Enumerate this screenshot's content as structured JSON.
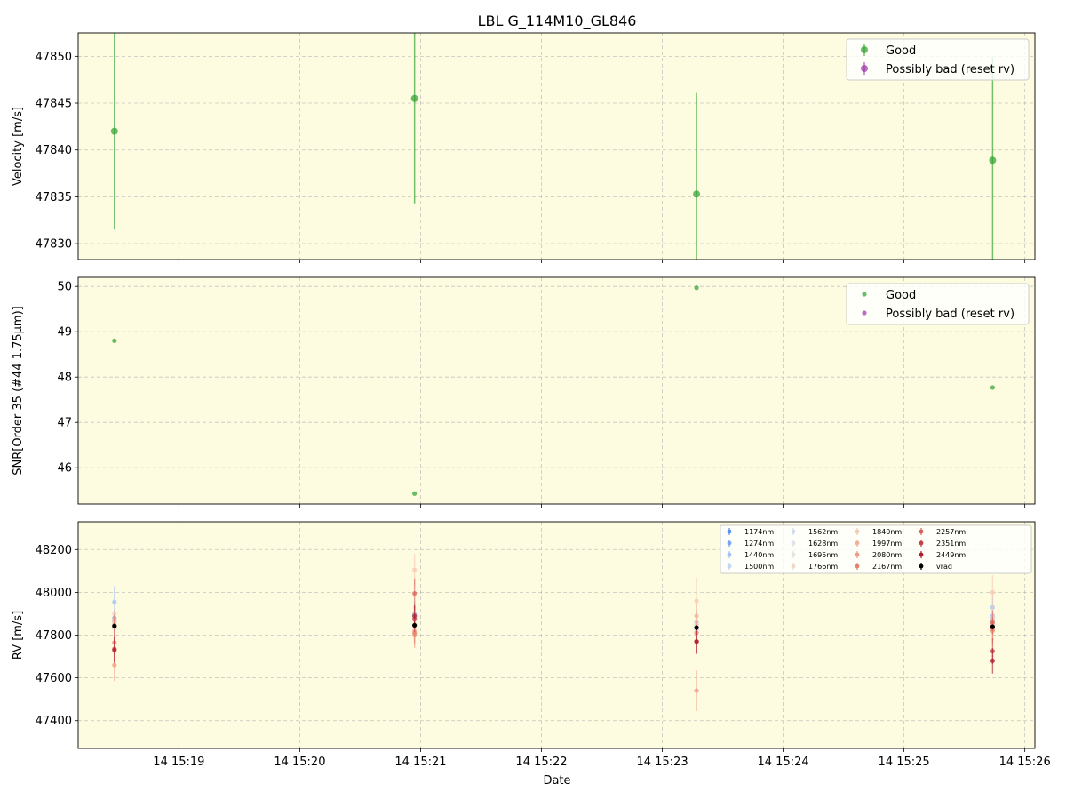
{
  "title": "LBL G_114M10_GL846",
  "xlabel": "Date",
  "x_tick_labels": [
    "14 15:19",
    "14 15:20",
    "14 15:21",
    "14 15:22",
    "14 15:23",
    "14 15:24",
    "14 15:25",
    "14 15:26"
  ],
  "colors": {
    "good": "#2ca02c",
    "bad": "#9b30a8",
    "panel_bg": "#fdfce0",
    "grid": "#b0b0b0",
    "vrad": "#000000"
  },
  "chart_data": [
    {
      "type": "scatter",
      "panel": "velocity",
      "ylabel": "Velocity [m/s]",
      "y_tick_labels": [
        "47830",
        "47835",
        "47840",
        "47845",
        "47850"
      ],
      "ylim": [
        47828.3,
        47852.5
      ],
      "xlim": [
        "15:18:10",
        "15:26:05"
      ],
      "grid": true,
      "legend_position": "upper right",
      "legend": [
        "Good",
        "Possibly bad (reset rv)"
      ],
      "series": [
        {
          "name": "Good",
          "color": "#2ca02c",
          "errorbars": true,
          "points": [
            {
              "x": "15:18:28",
              "y": 47842.0,
              "err": 10.5
            },
            {
              "x": "15:20:57",
              "y": 47845.5,
              "err": 11.2
            },
            {
              "x": "15:23:17",
              "y": 47835.3,
              "err": 10.8
            },
            {
              "x": "15:25:44",
              "y": 47838.9,
              "err": 11.0
            }
          ]
        },
        {
          "name": "Possibly bad (reset rv)",
          "color": "#9b30a8",
          "errorbars": true,
          "points": []
        }
      ]
    },
    {
      "type": "scatter",
      "panel": "snr",
      "ylabel": "SNR[Order 35 (#44 1.75μm)]",
      "y_tick_labels": [
        "46",
        "47",
        "48",
        "49",
        "50"
      ],
      "ylim": [
        45.2,
        50.2
      ],
      "xlim": [
        "15:18:10",
        "15:26:05"
      ],
      "grid": true,
      "legend_position": "upper right",
      "legend": [
        "Good",
        "Possibly bad (reset rv)"
      ],
      "series": [
        {
          "name": "Good",
          "color": "#2ca02c",
          "points": [
            {
              "x": "15:18:28",
              "y": 48.8
            },
            {
              "x": "15:20:57",
              "y": 45.43
            },
            {
              "x": "15:23:17",
              "y": 49.97
            },
            {
              "x": "15:25:44",
              "y": 47.77
            }
          ]
        },
        {
          "name": "Possibly bad (reset rv)",
          "color": "#9b30a8",
          "points": []
        }
      ]
    },
    {
      "type": "scatter",
      "panel": "rv",
      "ylabel": "RV [m/s]",
      "y_tick_labels": [
        "47400",
        "47600",
        "47800",
        "48000",
        "48200"
      ],
      "ylim": [
        47270,
        48330
      ],
      "xlim": [
        "15:18:10",
        "15:26:05"
      ],
      "grid": true,
      "legend_position": "upper right",
      "legend_columns": 5,
      "x": [
        "15:18:28",
        "15:20:57",
        "15:23:17",
        "15:25:44"
      ],
      "series": [
        {
          "name": "1174nm",
          "color": "#5b8ff0",
          "values": [
            47870,
            47880,
            47850,
            47880
          ],
          "err": [
            45,
            45,
            50,
            45
          ]
        },
        {
          "name": "1274nm",
          "color": "#7aa5f5",
          "values": [
            47880,
            47890,
            47830,
            47890
          ],
          "err": [
            40,
            40,
            45,
            40
          ]
        },
        {
          "name": "1440nm",
          "color": "#a3c1f7",
          "values": [
            47955,
            47900,
            47860,
            47930
          ],
          "err": [
            75,
            60,
            55,
            55
          ]
        },
        {
          "name": "1500nm",
          "color": "#c2d6f6",
          "values": [
            47860,
            47890,
            47840,
            47890
          ],
          "err": [
            55,
            45,
            45,
            45
          ]
        },
        {
          "name": "1562nm",
          "color": "#d0dcee",
          "values": [
            47900,
            47880,
            47850,
            47870
          ],
          "err": [
            45,
            40,
            45,
            40
          ]
        },
        {
          "name": "1628nm",
          "color": "#dde4ec",
          "values": [
            47830,
            47870,
            47820,
            47860
          ],
          "err": [
            50,
            45,
            45,
            45
          ]
        },
        {
          "name": "1695nm",
          "color": "#e6e3dc",
          "values": [
            47850,
            47880,
            47830,
            47860
          ],
          "err": [
            45,
            45,
            50,
            45
          ]
        },
        {
          "name": "1766nm",
          "color": "#f2d8cb",
          "values": [
            47870,
            47880,
            47850,
            47880
          ],
          "err": [
            40,
            40,
            45,
            40
          ]
        },
        {
          "name": "1840nm",
          "color": "#f6c9b2",
          "values": [
            47860,
            48105,
            47960,
            48000
          ],
          "err": [
            50,
            75,
            110,
            80
          ]
        },
        {
          "name": "1997nm",
          "color": "#f3b197",
          "values": [
            47870,
            47820,
            47890,
            47850
          ],
          "err": [
            50,
            50,
            55,
            50
          ]
        },
        {
          "name": "2080nm",
          "color": "#ef9a80",
          "values": [
            47660,
            47800,
            47540,
            47820
          ],
          "err": [
            75,
            60,
            95,
            60
          ]
        },
        {
          "name": "2167nm",
          "color": "#e6816c",
          "values": [
            47765,
            47810,
            47810,
            47830
          ],
          "err": [
            55,
            55,
            55,
            55
          ]
        },
        {
          "name": "2257nm",
          "color": "#d8615a",
          "values": [
            47845,
            47995,
            47770,
            47860
          ],
          "err": [
            50,
            70,
            55,
            55
          ]
        },
        {
          "name": "2351nm",
          "color": "#c8404a",
          "values": [
            47735,
            47875,
            47770,
            47725
          ],
          "err": [
            60,
            60,
            60,
            60
          ]
        },
        {
          "name": "2449nm",
          "color": "#b01b2e",
          "values": [
            47730,
            47890,
            47770,
            47680
          ],
          "err": [
            60,
            50,
            55,
            60
          ]
        },
        {
          "name": "vrad",
          "color": "#000000",
          "values": [
            47842,
            47846,
            47835,
            47839
          ],
          "err": [
            11,
            11,
            11,
            11
          ]
        }
      ]
    }
  ]
}
